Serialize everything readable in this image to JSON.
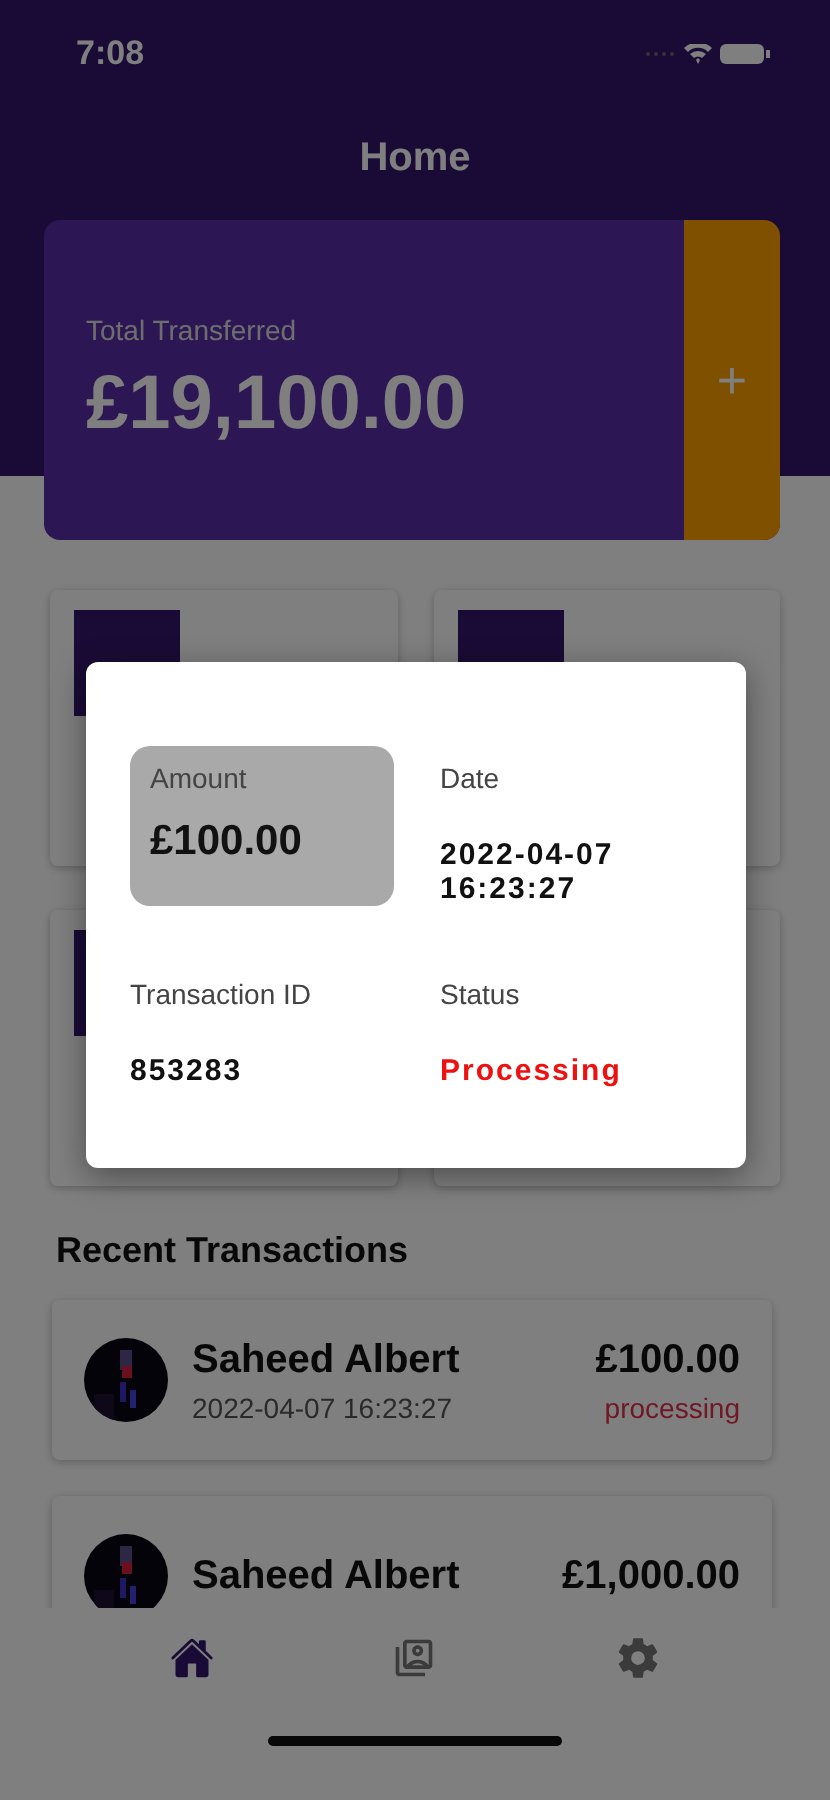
{
  "status_bar": {
    "time": "7:08"
  },
  "header": {
    "title": "Home"
  },
  "balance_card": {
    "label": "Total Transferred",
    "amount": "£19,100.00",
    "add_button": "+"
  },
  "modal": {
    "fields": [
      {
        "kind": "highlight",
        "label": "Amount",
        "value": "£100.00"
      },
      {
        "kind": "plain",
        "label": "Date",
        "value": "2022-04-07\n16:23:27"
      },
      {
        "kind": "plain",
        "label": "Transaction ID",
        "value": "853283"
      },
      {
        "kind": "status",
        "label": "Status",
        "value": "Processing"
      }
    ]
  },
  "recent_transactions": {
    "title": "Recent Transactions",
    "items": [
      {
        "name": "Saheed Albert",
        "date": "2022-04-07 16:23:27",
        "amount": "£100.00",
        "status": "processing"
      },
      {
        "name": "Saheed Albert",
        "amount": "£1,000.00"
      }
    ]
  },
  "tab_bar": [
    {
      "kind": "home",
      "selected": true
    },
    {
      "kind": "transfers",
      "selected": false
    },
    {
      "kind": "settings",
      "selected": false
    }
  ]
}
